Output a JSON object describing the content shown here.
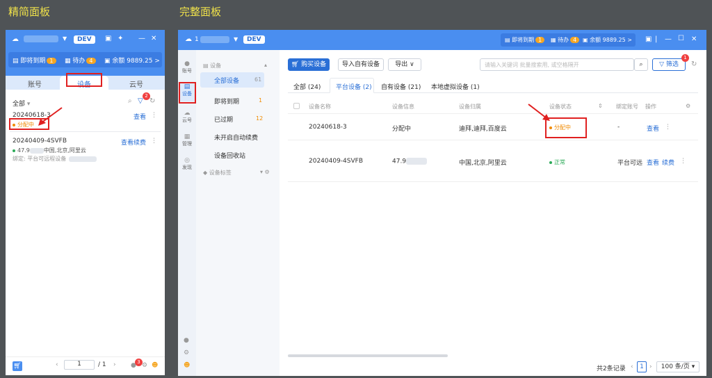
{
  "captions": {
    "compact": "精简面板",
    "full": "完整面板"
  },
  "compact": {
    "dev": "DEV",
    "stats": {
      "expiring": "即将到期",
      "expiring_n": "1",
      "todo": "待办",
      "todo_n": "4",
      "balance": "余额 9889.25",
      "arrow": ">"
    },
    "tabs": [
      "账号",
      "设备",
      "云号"
    ],
    "filter_label": "全部",
    "filter_badge": "2",
    "devices": [
      {
        "name": "20240618-3",
        "status": "分配中",
        "action": "查看"
      },
      {
        "name": "20240409-4SVFB",
        "region": "中国,北京,阿里云",
        "ip_prefix": "47.9",
        "bind": "绑定: 平台可远程设备",
        "actions": [
          "查看",
          "续费"
        ]
      }
    ],
    "pager": {
      "page": "1",
      "total": "/ 1"
    },
    "footer_badge": "3"
  },
  "full": {
    "dev": "DEV",
    "title_prefix": "1",
    "stats": {
      "expiring": "即将到期",
      "expiring_n": "1",
      "todo": "待办",
      "todo_n": "4",
      "balance": "余额 9889.25",
      "arrow": ">"
    },
    "rail": [
      {
        "label": "账号",
        "icon": "user-icon"
      },
      {
        "label": "设备",
        "icon": "device-icon"
      },
      {
        "label": "云号",
        "icon": "cloud-icon"
      },
      {
        "label": "管理",
        "icon": "manage-icon"
      },
      {
        "label": "发现",
        "icon": "discover-icon"
      }
    ],
    "nav": {
      "header": "设备",
      "items": [
        {
          "label": "全部设备",
          "count": "61"
        },
        {
          "label": "即将到期",
          "count": "1"
        },
        {
          "label": "已过期",
          "count": "12"
        },
        {
          "label": "未开启自动续费",
          "count": ""
        },
        {
          "label": "设备回收站",
          "count": ""
        }
      ],
      "tags": "设备标签"
    },
    "toolbar": {
      "buy": "购买设备",
      "import": "导入自有设备",
      "export": "导出",
      "search_placeholder": "请输入关键词 批量搜索用, 或空格隔开",
      "filter": "筛选",
      "filter_badge": "1"
    },
    "tabs": [
      "全部 (24)",
      "平台设备 (2)",
      "自有设备 (21)",
      "本地虚拟设备 (1)"
    ],
    "columns": [
      "设备名称",
      "设备信息",
      "设备归属",
      "设备状态",
      "绑定账号",
      "操作"
    ],
    "rows": [
      {
        "name": "20240618-3",
        "info": "分配中",
        "region": "迪拜,迪拜,百度云",
        "status": "分配中",
        "account": "-",
        "actions": [
          "查看"
        ]
      },
      {
        "name": "20240409-4SVFB",
        "info": "47.9",
        "region": "中国,北京,阿里云",
        "status": "正常",
        "account": "平台可远",
        "actions": [
          "查看",
          "续费"
        ]
      }
    ],
    "footer": {
      "total": "共2条记录",
      "page": "1",
      "per_page": "100 条/页"
    }
  },
  "colors": {
    "primary": "#4a8ef0",
    "accent": "#2a6fd6",
    "warning": "#f08a00",
    "success": "#2eab5a",
    "highlight": "#e02020"
  }
}
